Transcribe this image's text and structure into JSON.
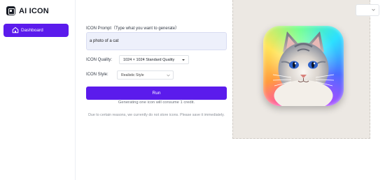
{
  "brand": {
    "name": "AI ICON"
  },
  "sidebar": {
    "items": [
      {
        "label": "Dashboard",
        "icon": "home-icon",
        "active": true
      }
    ]
  },
  "form": {
    "prompt_label": "ICON Prompt（Type what you want to generate）",
    "prompt_value": "a photo of a cat",
    "quality_label": "ICON Quality:",
    "quality_value": "1024 × 1024 Standard Quality",
    "style_label": "ICON Style:",
    "style_value": "Realistic Style",
    "run_label": "Run",
    "credit_note": "Generating one icon will consume 1 credit.",
    "storage_note": "Due to certain reasons, we currently do not store icons. Please save it immediately."
  },
  "preview": {
    "subject": "cat-icon"
  },
  "colors": {
    "accent": "#5b1bec",
    "prompt_bg": "#edf0fb",
    "preview_bg": "#ece8e3"
  }
}
